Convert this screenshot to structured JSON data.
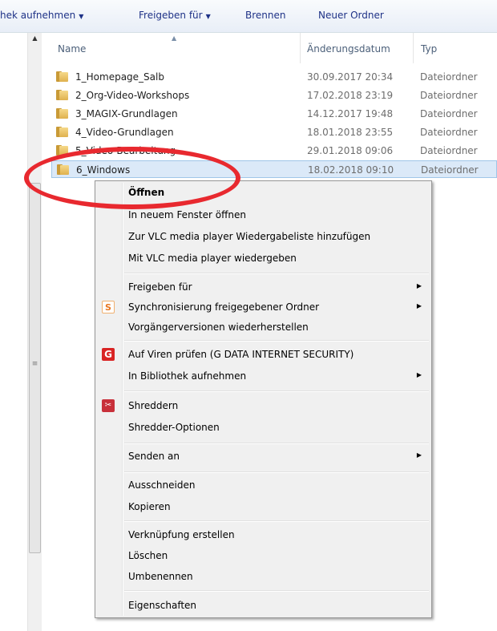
{
  "toolbar": {
    "buttons": [
      {
        "label": "hek aufnehmen",
        "arrow": "▼"
      },
      {
        "label": "Freigeben für",
        "arrow": "▼"
      },
      {
        "label": "Brennen"
      },
      {
        "label": "Neuer Ordner"
      }
    ]
  },
  "columns": {
    "name": "Name",
    "date": "Änderungsdatum",
    "type": "Typ"
  },
  "files": [
    {
      "name": "1_Homepage_Salb",
      "date": "30.09.2017 20:34",
      "type": "Dateiordner"
    },
    {
      "name": "2_Org-Video-Workshops",
      "date": "17.02.2018 23:19",
      "type": "Dateiordner"
    },
    {
      "name": "3_MAGIX-Grundlagen",
      "date": "14.12.2017 19:48",
      "type": "Dateiordner"
    },
    {
      "name": "4_Video-Grundlagen",
      "date": "18.01.2018 23:55",
      "type": "Dateiordner"
    },
    {
      "name": "5_Video-Bearbeitung",
      "date": "29.01.2018 09:06",
      "type": "Dateiordner"
    },
    {
      "name": "6_Windows",
      "date": "18.02.2018 09:10",
      "type": "Dateiordner",
      "selected": true
    }
  ],
  "context_menu": {
    "items": [
      {
        "label": "Öffnen",
        "bold": true
      },
      {
        "label": "In neuem Fenster öffnen"
      },
      {
        "label": "Zur VLC media player Wiedergabeliste hinzufügen"
      },
      {
        "label": "Mit VLC media player wiedergeben"
      },
      {
        "label": "Freigeben für",
        "submenu": true
      },
      {
        "label": "Synchronisierung freigegebener Ordner",
        "submenu": true,
        "icon": "sync-icon"
      },
      {
        "label": "Vorgängerversionen wiederherstellen"
      },
      {
        "label": "Auf Viren prüfen (G DATA INTERNET SECURITY)",
        "icon": "gdata-shield-icon"
      },
      {
        "label": "In Bibliothek aufnehmen",
        "submenu": true
      },
      {
        "label": "Shreddern",
        "icon": "shredder-icon"
      },
      {
        "label": "Shredder-Optionen"
      },
      {
        "label": "Senden an",
        "submenu": true
      },
      {
        "label": "Ausschneiden"
      },
      {
        "label": "Kopieren"
      },
      {
        "label": "Verknüpfung erstellen"
      },
      {
        "label": "Löschen"
      },
      {
        "label": "Umbenennen"
      },
      {
        "label": "Eigenschaften"
      }
    ],
    "submenu_arrow": "▶",
    "icon_glyphs": {
      "sync": "S",
      "gdata": "G",
      "shred": "✂"
    }
  },
  "colors": {
    "highlight_ellipse": "#e8292f",
    "selection_bg": "#dbe9f8",
    "toolbar_text": "#1e3287"
  }
}
